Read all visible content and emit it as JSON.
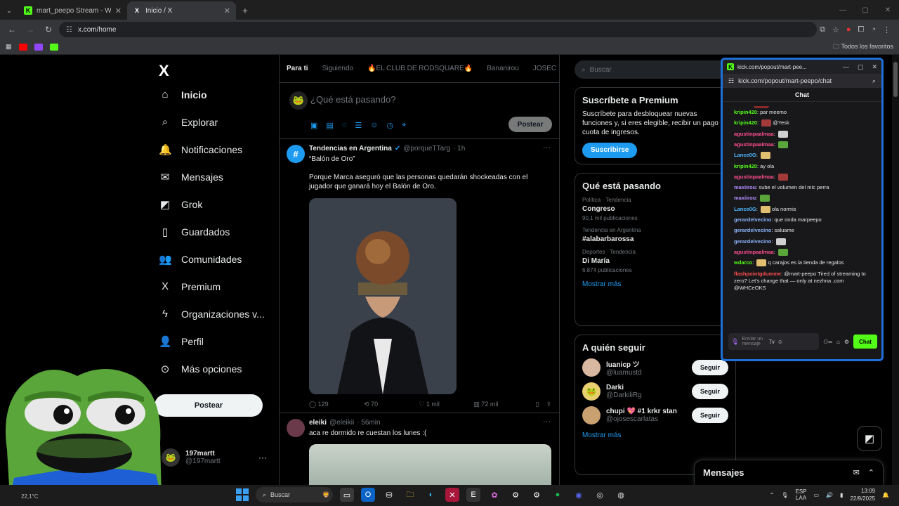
{
  "browser": {
    "tabs": [
      {
        "label": "mart_peepo Stream - Watch Li...",
        "favicon": "K",
        "active": false
      },
      {
        "label": "Inicio / X",
        "favicon": "X",
        "active": true
      }
    ],
    "new_tab": "+",
    "url": "x.com/home",
    "bookmarks_folder": "Todos los favoritos"
  },
  "x": {
    "logo": "X",
    "nav": [
      {
        "label": "Inicio",
        "icon": "home-icon",
        "glyph": "⌂",
        "active": true
      },
      {
        "label": "Explorar",
        "icon": "search-icon",
        "glyph": "⌕"
      },
      {
        "label": "Notificaciones",
        "icon": "bell-icon",
        "glyph": "🔔"
      },
      {
        "label": "Mensajes",
        "icon": "envelope-icon",
        "glyph": "✉"
      },
      {
        "label": "Grok",
        "icon": "grok-icon",
        "glyph": "◩"
      },
      {
        "label": "Guardados",
        "icon": "bookmark-icon",
        "glyph": "▯"
      },
      {
        "label": "Comunidades",
        "icon": "communities-icon",
        "glyph": "👥"
      },
      {
        "label": "Premium",
        "icon": "x-premium-icon",
        "glyph": "X"
      },
      {
        "label": "Organizaciones v...",
        "icon": "lightning-icon",
        "glyph": "ϟ"
      },
      {
        "label": "Perfil",
        "icon": "person-icon",
        "glyph": "👤"
      },
      {
        "label": "Más opciones",
        "icon": "more-circle-icon",
        "glyph": "⊙"
      }
    ],
    "post_button": "Postear",
    "account": {
      "name": "197martt",
      "handle": "@197martt"
    },
    "feed_tabs": [
      "Para ti",
      "Siguiendo",
      "🔥EL CLUB DE RODSQUARE🔥",
      "Bananirou",
      "JOSEC"
    ],
    "composer": {
      "placeholder": "¿Qué está pasando?",
      "post": "Postear"
    },
    "tweets": [
      {
        "name": "Tendencias en Argentina",
        "handle": "@porqueTTarg",
        "time": "· 1h",
        "text": "“Balón de Oro”\n\nPorque Marca aseguró que las personas quedarán shockeadas con el jugador que ganará hoy el Balón de Oro.",
        "replies": "129",
        "reposts": "70",
        "likes": "1 mil",
        "views": "72 mil"
      },
      {
        "name": "eleiki",
        "handle": "@eleikii",
        "time": "· 56min",
        "text": "aca re dormido re cuestan los lunes :("
      }
    ],
    "search_placeholder": "Buscar",
    "premium": {
      "title": "Suscríbete a Premium",
      "body": "Suscríbete para desbloquear nuevas funciones y, si eres elegible, recibir un pago de cuota de ingresos.",
      "button": "Suscribirse"
    },
    "trending": {
      "title": "Qué está pasando",
      "items": [
        {
          "context": "Política · Tendencia",
          "topic": "Congreso",
          "count": "90,1 mil publicaciones"
        },
        {
          "context": "Tendencia en Argentina",
          "topic": "#alabarbarossa",
          "count": ""
        },
        {
          "context": "Deportes · Tendencia",
          "topic": "Di María",
          "count": "6.874 publicaciones"
        }
      ],
      "show_more": "Mostrar más"
    },
    "who_to_follow": {
      "title": "A quién seguir",
      "items": [
        {
          "name": "luanicp ツ",
          "handle": "@luamustd",
          "button": "Seguir"
        },
        {
          "name": "Darki",
          "handle": "@DarkiliRg",
          "button": "Seguir"
        },
        {
          "name": "chupi 💖 #1 krkr stan",
          "handle": "@ojosescarlatas",
          "button": "Seguir"
        }
      ],
      "show_more": "Mostrar más"
    },
    "messages_drawer": "Mensajes"
  },
  "kick": {
    "window_title": "kick.com/popout/mart-pee...",
    "url": "kick.com/popout/mart-peepo/chat",
    "header": "Chat",
    "messages": [
      {
        "user": "kripin420",
        "color": "#53fc18",
        "text": "par meemo",
        "emote": false
      },
      {
        "user": "kripin420",
        "color": "#53fc18",
        "text": "@Yesk",
        "emote": true
      },
      {
        "user": "agustinpaalmaa",
        "color": "#ff4d8d",
        "text": "",
        "emote": true
      },
      {
        "user": "agustinpaalmaa",
        "color": "#ff4d8d",
        "text": "",
        "emote": true
      },
      {
        "user": "Lance0G",
        "color": "#4db8ff",
        "text": "",
        "emote": true
      },
      {
        "user": "kripin420",
        "color": "#53fc18",
        "text": "ay ola",
        "emote": false
      },
      {
        "user": "agustinpaalmaa",
        "color": "#ff4d8d",
        "text": "",
        "emote": true
      },
      {
        "user": "maxiirou",
        "color": "#b28dff",
        "text": "sube el volumen del mic perra",
        "emote": false
      },
      {
        "user": "maxiirou",
        "color": "#b28dff",
        "text": "",
        "emote": true
      },
      {
        "user": "Lance0G",
        "color": "#4db8ff",
        "text": "ola normis",
        "emote": true
      },
      {
        "user": "gerardelvecino",
        "color": "#8ab4f8",
        "text": "que onda marpeepo",
        "emote": false
      },
      {
        "user": "gerardelvecino",
        "color": "#8ab4f8",
        "text": "saluame",
        "emote": false
      },
      {
        "user": "gerardelvecino",
        "color": "#8ab4f8",
        "text": "",
        "emote": true
      },
      {
        "user": "agustinpaalmaa",
        "color": "#ff4d8d",
        "text": "",
        "emote": true
      },
      {
        "user": "wdarco",
        "color": "#53fc18",
        "text": "q carajos es la tienda de regalos",
        "emote": true
      },
      {
        "user": "flashpointgdumme",
        "color": "#ff4d4d",
        "text": "@mart-peepo Tired of streaming to zero? Let's change that — only at nezhna .com @WHCeOKS",
        "emote": false
      }
    ],
    "input_placeholder": "Enviar un mensaje",
    "send": "Chat"
  },
  "taskbar": {
    "weather": "22,1°C",
    "search": "Buscar",
    "lang": "ESP",
    "lang2": "LAA",
    "time": "13:09",
    "date": "22/9/2025"
  }
}
